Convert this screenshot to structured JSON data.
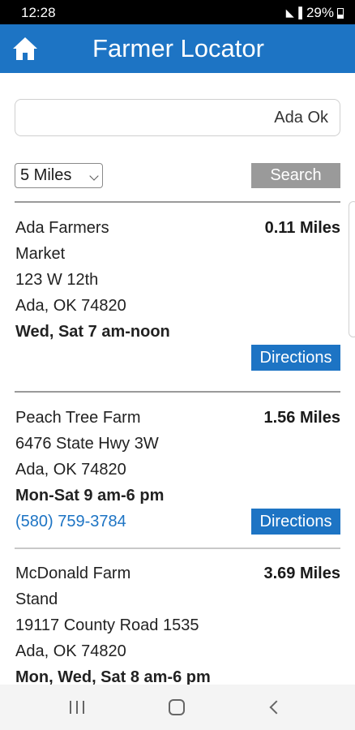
{
  "status_bar": {
    "time": "12:28",
    "battery": "29%",
    "icons": "wifi-icon, signal-icon, battery-icon"
  },
  "header": {
    "title": "Farmer Locator",
    "home_icon": "home-icon",
    "color": "#1d74c4"
  },
  "search": {
    "value": "Ada Ok",
    "distance": "5 Miles",
    "button": "Search"
  },
  "results": [
    {
      "name_lines": [
        "Ada Farmers",
        "Market"
      ],
      "address": "123 W 12th",
      "city": "Ada, OK 74820",
      "hours": "Wed, Sat 7 am-noon",
      "distance": "0.11 Miles",
      "directions": "Directions"
    },
    {
      "name_lines": [
        "Peach Tree Farm"
      ],
      "address": "6476 State Hwy 3W",
      "city": "Ada, OK 74820",
      "hours": "Mon-Sat 9 am-6 pm",
      "phone": "(580) 759-3784",
      "distance": "1.56 Miles",
      "directions": "Directions"
    },
    {
      "name_lines": [
        "McDonald Farm",
        "Stand"
      ],
      "address": "19117 County Road 1535",
      "city": "Ada, OK 74820",
      "hours": "Mon, Wed, Sat 8 am-6 pm",
      "distance": "3.69 Miles"
    }
  ],
  "nav": {
    "recents_icon": "recents-icon",
    "home_icon": "nav-home-icon",
    "back_icon": "back-icon"
  }
}
